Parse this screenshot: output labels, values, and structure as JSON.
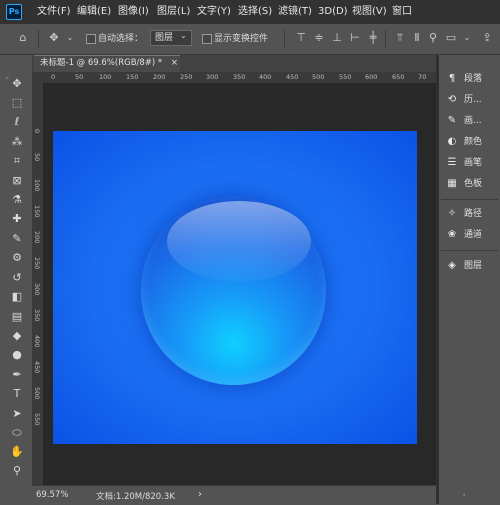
{
  "app": {
    "logo": "Ps"
  },
  "menu": [
    {
      "label": "文件(F)"
    },
    {
      "label": "编辑(E)"
    },
    {
      "label": "图像(I)"
    },
    {
      "label": "图层(L)"
    },
    {
      "label": "文字(Y)"
    },
    {
      "label": "选择(S)"
    },
    {
      "label": "滤镜(T)"
    },
    {
      "label": "3D(D)"
    },
    {
      "label": "视图(V)"
    },
    {
      "label": "窗口"
    }
  ],
  "options": {
    "auto_select_label": "自动选择：",
    "auto_select_target": "图层",
    "transform_controls_label": "显示变换控件"
  },
  "document": {
    "tab_title": "未标题-1 @ 69.6%(RGB/8#) *",
    "close_glyph": "×"
  },
  "ruler": {
    "h_ticks": [
      "0",
      "50",
      "100",
      "150",
      "200",
      "250",
      "300",
      "350",
      "400",
      "450",
      "500",
      "550",
      "600",
      "650",
      "70"
    ],
    "v_ticks": [
      "0",
      "50",
      "100",
      "150",
      "200",
      "250",
      "300",
      "350",
      "400",
      "450",
      "500",
      "550"
    ]
  },
  "status": {
    "zoom": "69.57%",
    "doc_size": "文档:1.20M/820.3K",
    "arrow": "›"
  },
  "panels": {
    "group1": [
      {
        "icon": "paragraph-icon",
        "glyph": "¶",
        "label": "段落"
      },
      {
        "icon": "history-icon",
        "glyph": "⟲",
        "label": "历..."
      },
      {
        "icon": "brush-icon",
        "glyph": "✎",
        "label": "画..."
      },
      {
        "icon": "color-icon",
        "glyph": "◐",
        "label": "颜色"
      },
      {
        "icon": "brush-settings-icon",
        "glyph": "☰",
        "label": "画笔"
      },
      {
        "icon": "swatches-icon",
        "glyph": "▦",
        "label": "色板"
      }
    ],
    "group2": [
      {
        "icon": "paths-icon",
        "glyph": "✧",
        "label": "路径"
      },
      {
        "icon": "channels-icon",
        "glyph": "❀",
        "label": "通道"
      }
    ],
    "group3": [
      {
        "icon": "layers-icon",
        "glyph": "◈",
        "label": "图层"
      }
    ]
  },
  "watermark": "ꞏ"
}
